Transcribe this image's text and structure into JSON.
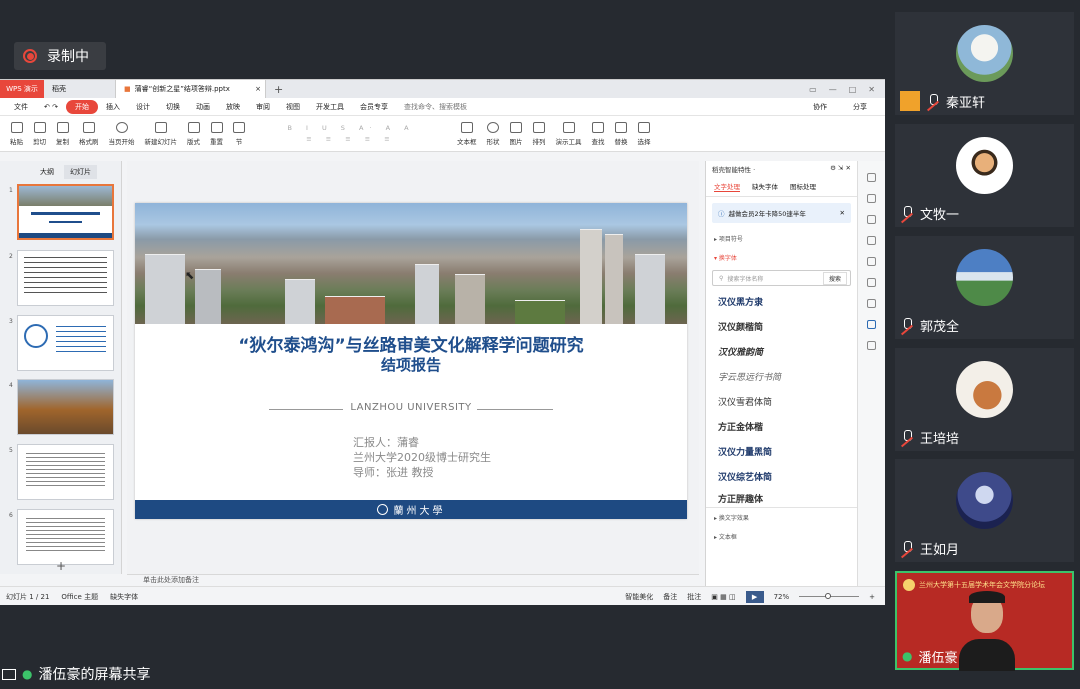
{
  "recording": {
    "label": "录制中"
  },
  "app": {
    "tabs": {
      "wps": "WPS 演示",
      "daoke": "稻壳",
      "file": "蒲睿“创新之星”结项答辩.pptx"
    },
    "menu": {
      "file": "文件",
      "items": [
        "开始",
        "插入",
        "设计",
        "切换",
        "动画",
        "放映",
        "审阅",
        "视图",
        "开发工具",
        "会员专享"
      ],
      "search": "查找命令、搜索模板",
      "right": [
        "协作",
        "分享"
      ]
    },
    "ribbon": [
      "粘贴",
      "剪切",
      "复制",
      "格式刷",
      "当页开始",
      "新建幻灯片",
      "版式",
      "重置",
      "节",
      "文本框",
      "形状",
      "图片",
      "排列",
      "演示工具",
      "查找",
      "替换",
      "选择"
    ],
    "left_pane": {
      "tab_outline": "大纲",
      "tab_slides": "幻灯片",
      "numbers": [
        "1",
        "2",
        "3",
        "4",
        "5",
        "6"
      ]
    },
    "slide": {
      "title_line1": "“狄尔泰鸿沟”与丝路审美文化解释学问题研究",
      "title_line2": "结项报告",
      "university": "LANZHOU UNIVERSITY",
      "reporter": "汇报人：蒲睿",
      "affiliation": "兰州大学2020级博士研究生",
      "advisor": "导师：张进 教授",
      "footer_logo": "蘭州大學"
    },
    "notes": "单击此处添加备注",
    "panel": {
      "header": "稻壳智能特性 ·",
      "tabs": [
        "文字处理",
        "缺失字体",
        "图标处理"
      ],
      "tip": "越做会员2年卡降50速半年",
      "section1": "▸ 项目符号",
      "section2": "▾ 换字体",
      "search_placeholder": "搜索字体名称",
      "search_btn": "搜索",
      "fonts": [
        "汉仪黑方隶",
        "汉仪颜楷简",
        "汉仪雅韵简",
        "字云思远行书简",
        "汉仪雪君体简",
        "方正金体楷",
        "汉仪力量黑简",
        "汉仪综艺体简",
        "方正胖趣体"
      ],
      "section3": "▸ 换文字效果",
      "section4": "▸ 文本框"
    },
    "status": {
      "slide": "幻灯片 1 / 21",
      "theme": "Office 主题",
      "missing_font": "缺失字体",
      "beautify": "智能美化",
      "notes": "备注",
      "comment": "批注",
      "zoom": "72%"
    }
  },
  "participants": [
    {
      "name": "秦亚轩",
      "avatar": "goose-avatar"
    },
    {
      "name": "文牧一",
      "avatar": "cartoon-avatar"
    },
    {
      "name": "郭茂全",
      "avatar": "mountain-avatar"
    },
    {
      "name": "王培培",
      "avatar": "dog-avatar"
    },
    {
      "name": "王如月",
      "avatar": "anime-avatar"
    },
    {
      "name": "潘伍豪",
      "banner": "兰州大学第十五届学术年会文学院分论坛"
    }
  ],
  "share": {
    "label": "潘伍豪的屏幕共享"
  }
}
